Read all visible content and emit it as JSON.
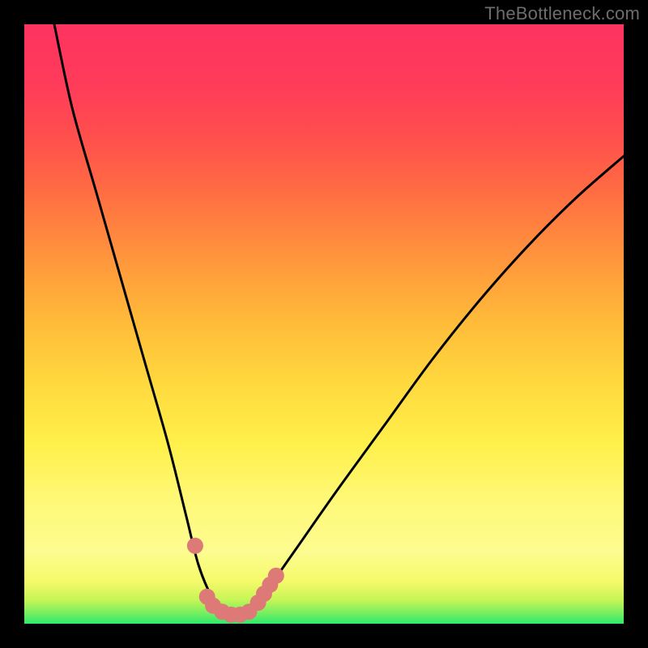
{
  "watermark": "TheBottleneck.com",
  "chart_data": {
    "type": "line",
    "title": "",
    "xlabel": "",
    "ylabel": "",
    "xlim": [
      0,
      100
    ],
    "ylim": [
      0,
      100
    ],
    "series": [
      {
        "name": "bottleneck-curve",
        "x": [
          5,
          8,
          12,
          16,
          20,
          24,
          27,
          29,
          31,
          33,
          35,
          37,
          40,
          45,
          52,
          60,
          68,
          76,
          84,
          92,
          100
        ],
        "y": [
          100,
          86,
          72,
          58,
          44,
          30,
          18,
          10,
          5,
          2,
          1,
          2,
          5,
          12,
          22,
          33,
          44,
          54,
          63,
          71,
          78
        ]
      }
    ],
    "markers": {
      "name": "highlight-dots",
      "color": "#dd7a77",
      "points": [
        {
          "x": 28.5,
          "y": 13
        },
        {
          "x": 30.5,
          "y": 4.5
        },
        {
          "x": 31.5,
          "y": 3
        },
        {
          "x": 33.0,
          "y": 2
        },
        {
          "x": 34.5,
          "y": 1.5
        },
        {
          "x": 36.0,
          "y": 1.5
        },
        {
          "x": 37.5,
          "y": 2
        },
        {
          "x": 39.0,
          "y": 3.5
        },
        {
          "x": 40.0,
          "y": 5
        },
        {
          "x": 41.0,
          "y": 6.5
        },
        {
          "x": 42.0,
          "y": 8
        }
      ]
    },
    "gradient_stops": [
      {
        "pos": 0.0,
        "color": "#2ee96e"
      },
      {
        "pos": 0.12,
        "color": "#fdfc90"
      },
      {
        "pos": 0.5,
        "color": "#ffbc3a"
      },
      {
        "pos": 1.0,
        "color": "#fd3360"
      }
    ]
  }
}
